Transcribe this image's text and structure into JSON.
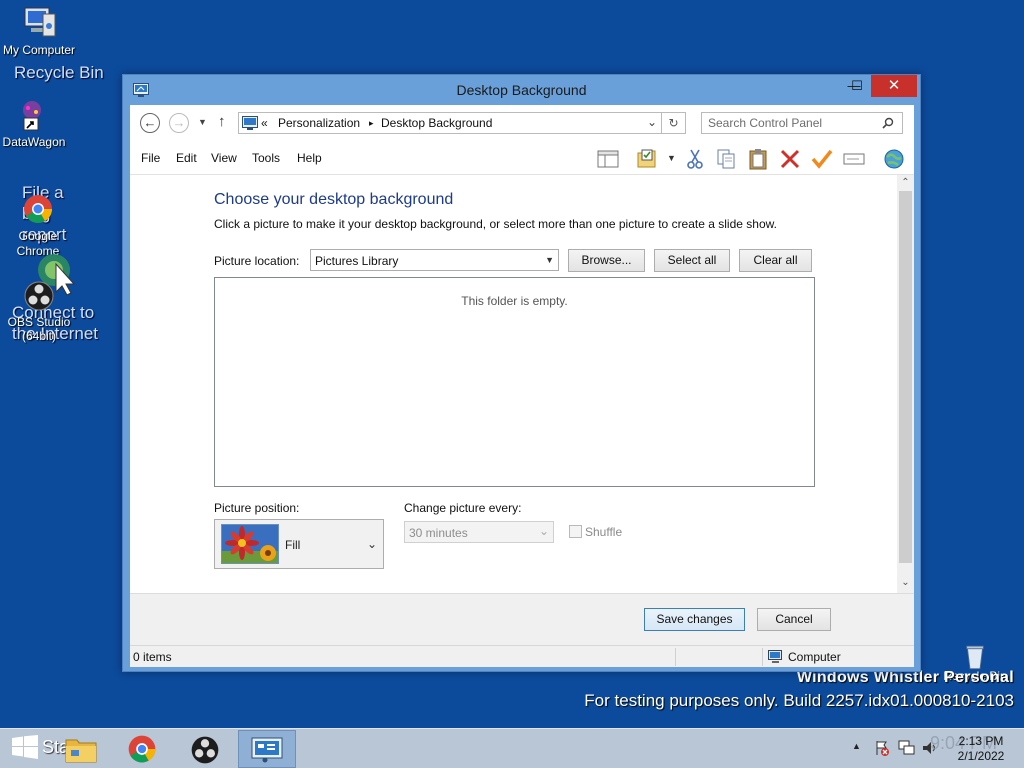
{
  "desktop": {
    "icons": [
      {
        "label": "My Computer"
      },
      {
        "label": "DataWagon"
      },
      {
        "label": "Google Chrome"
      },
      {
        "label": "OBS Studio (64bit)"
      }
    ],
    "ghost_labels": [
      "Recycle Bin",
      "File a bug report",
      "Connect to the Internet"
    ],
    "recycle_bin": "Recycle Bin",
    "watermark_line1": "Windows Whistler Personal",
    "watermark_line2": "For testing purposes only. Build 2257.idx01.000810-2103"
  },
  "window": {
    "title": "Desktop Background",
    "controls": {
      "minimize": "—",
      "maximize": "☐",
      "close": "✕"
    },
    "address": {
      "breadcrumb_prefix": "«",
      "crumbs": [
        "Personalization",
        "Desktop Background"
      ],
      "separator": "▸"
    },
    "search_placeholder": "Search Control Panel",
    "menu": [
      "File",
      "Edit",
      "View",
      "Tools",
      "Help"
    ],
    "content": {
      "heading": "Choose your desktop background",
      "description": "Click a picture to make it your desktop background, or select more than one picture to create a slide show.",
      "picture_location_label": "Picture location:",
      "picture_location_value": "Pictures Library",
      "browse": "Browse...",
      "select_all": "Select all",
      "clear_all": "Clear all",
      "empty_message": "This folder is empty.",
      "picture_position_label": "Picture position:",
      "picture_position_value": "Fill",
      "change_every_label": "Change picture every:",
      "change_every_value": "30 minutes",
      "shuffle_label": "Shuffle"
    },
    "footer": {
      "save": "Save changes",
      "cancel": "Cancel"
    },
    "status": {
      "items": "0 items",
      "location": "Computer"
    }
  },
  "taskbar": {
    "start_label": "Start",
    "time": "2:13 PM",
    "date": "2/1/2022",
    "ghost_time": "9:04 PM"
  },
  "colors": {
    "desktop": "#0c4a9b",
    "close": "#c7302b",
    "heading": "#1e3b8a"
  }
}
